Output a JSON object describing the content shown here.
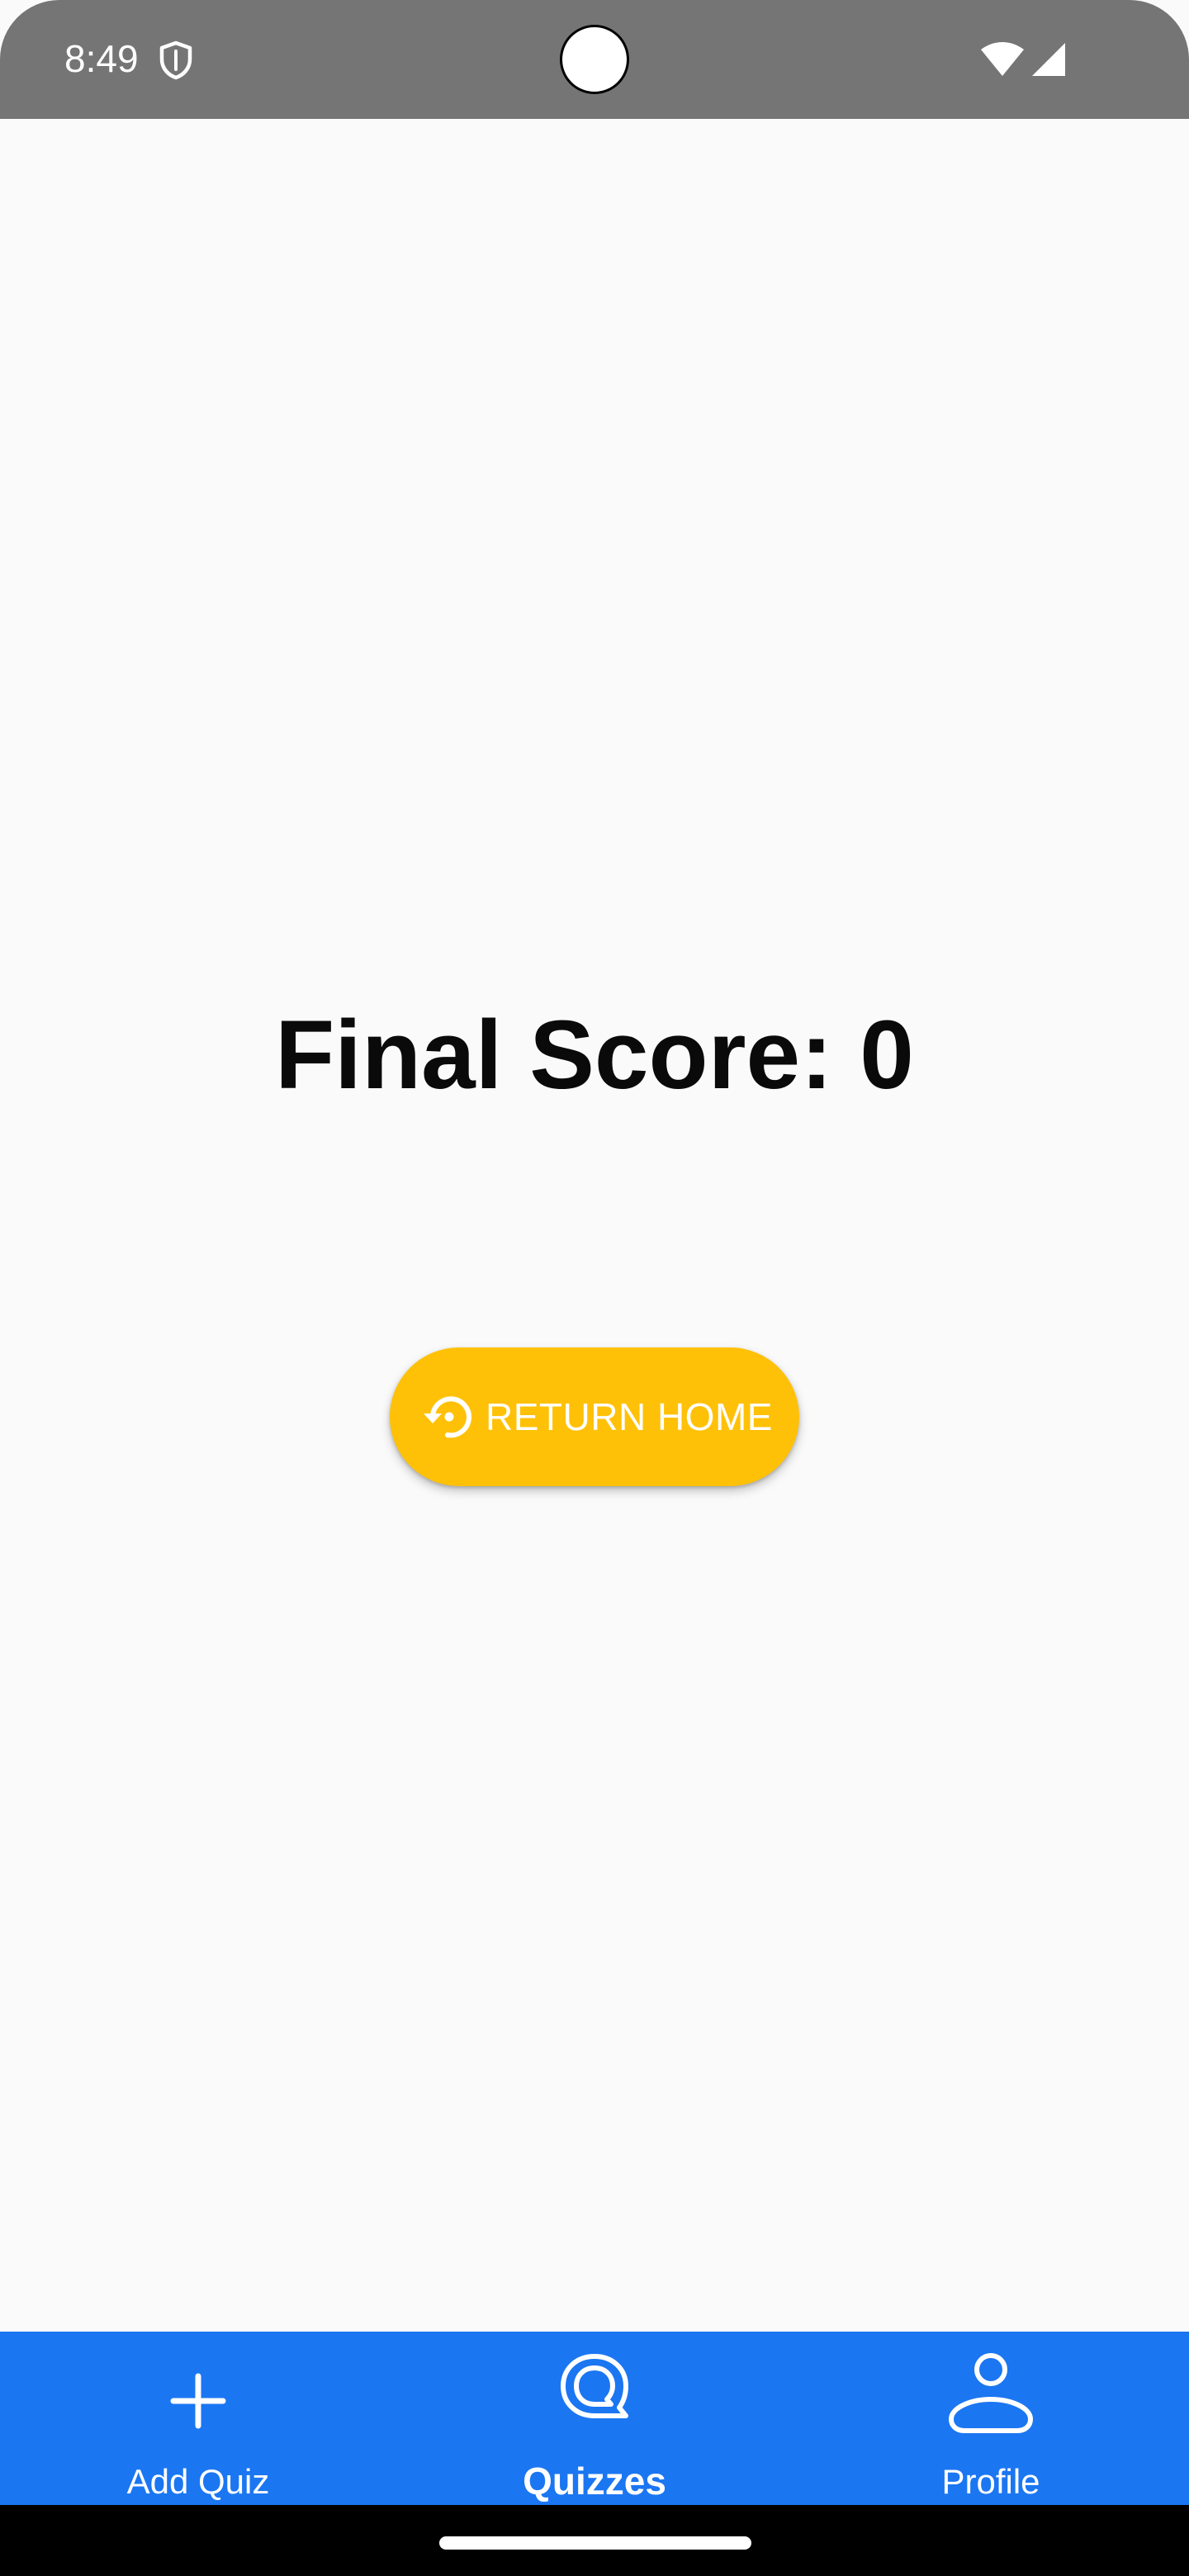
{
  "status_bar": {
    "time": "8:49",
    "icons": [
      "shield-icon",
      "wifi-icon",
      "signal-icon"
    ],
    "background_color": "#757575"
  },
  "main": {
    "final_score_text": "Final Score: 0",
    "return_home_button": {
      "label": "RETURN HOME",
      "icon": "restore-icon",
      "color": "#ffc107"
    }
  },
  "bottom_nav": {
    "background_color": "#1b76f2",
    "items": [
      {
        "label": "Add Quiz",
        "icon": "plus-icon",
        "active": false
      },
      {
        "label": "Quizzes",
        "icon": "quiz-bubble-icon",
        "active": true
      },
      {
        "label": "Profile",
        "icon": "person-icon",
        "active": false
      }
    ]
  }
}
